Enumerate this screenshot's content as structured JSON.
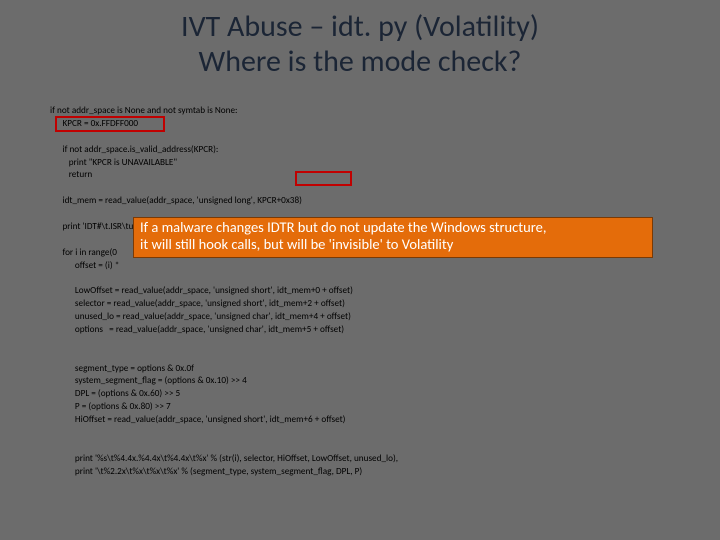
{
  "title_line1": "IVT Abuse – idt. py (Volatility)",
  "title_line2": "Where is the mode check?",
  "code": {
    "l01": "if not addr_space is None and not symtab is None:",
    "l02": "      KPCR = 0x.FFDFF000",
    "l03": "",
    "l04": "      if not addr_space.is_valid_address(KPCR):",
    "l05": "         print \"KPCR is UNAVAILABLE\"",
    "l06": "         return",
    "l07": "",
    "l08": "      idt_mem = read_value(addr_space, 'unsigned long', KPCR+0x38)",
    "l09": "",
    "l10": "      print 'IDT#\\t.ISR\\tunused_lo\\tsegment_type\\tsystem_segment_flag\\t.DPL\\t.P'",
    "l11": "",
    "l12": "      for i in range(0",
    "l13": "            offset = (i) *",
    "l14": "",
    "l15": "            LowOffset = read_value(addr_space, 'unsigned short', idt_mem+0 + offset)",
    "l16": "            selector = read_value(addr_space, 'unsigned short', idt_mem+2 + offset)",
    "l17": "            unused_lo = read_value(addr_space, 'unsigned char', idt_mem+4 + offset)",
    "l18": "            options   = read_value(addr_space, 'unsigned char', idt_mem+5 + offset)",
    "l19": "",
    "l20": "",
    "l21": "            segment_type = options & 0x.0f",
    "l22": "            system_segment_flag = (options & 0x.10) >> 4",
    "l23": "            DPL = (options & 0x.60) >> 5",
    "l24": "            P = (options & 0x.80) >> 7",
    "l25": "            HiOffset = read_value(addr_space, 'unsigned short', idt_mem+6 + offset)",
    "l26": "",
    "l27": "",
    "l28": "            print '%s\\t%4.4x.%4.4x\\t%4.4x\\t%x' % (str(i), selector, HiOffset, LowOffset, unused_lo),",
    "l29": "            print '\\t%2.2x\\t%x\\t%x\\t%x' % (segment_type, system_segment_flag, DPL, P)"
  },
  "callout": {
    "line1": "If a malware changes IDTR but do not update the Windows structure,",
    "line2": "it will still hook calls, but will be 'invisible' to Volatility"
  }
}
